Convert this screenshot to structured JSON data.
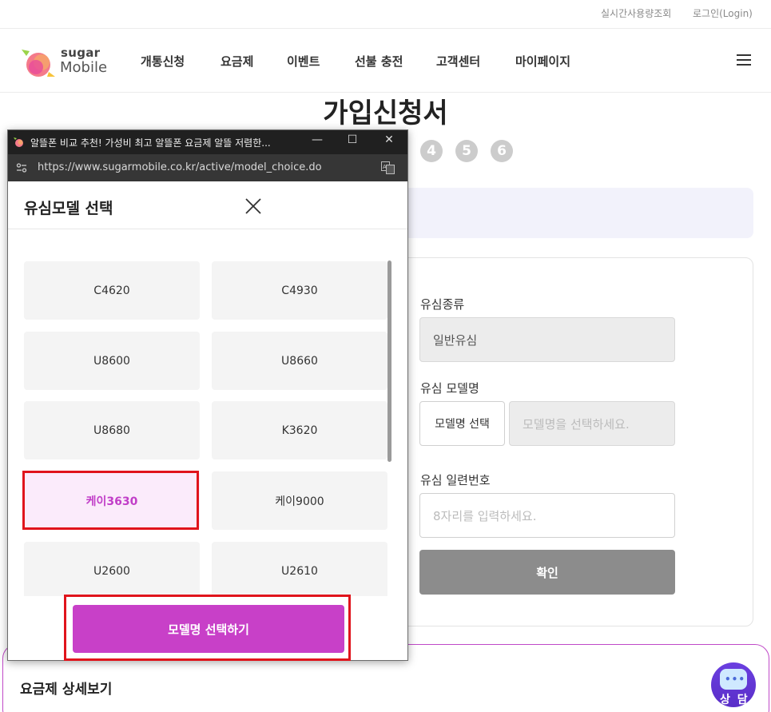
{
  "topbar": {
    "realtime_usage": "실시간사용량조회",
    "login": "로그인(Login)"
  },
  "header": {
    "logo": {
      "line1": "sugar",
      "line2": "Mobile"
    },
    "nav": [
      "개통신청",
      "요금제",
      "이벤트",
      "선불 충전",
      "고객센터",
      "마이페이지"
    ],
    "menu_icon": "hamburger-icon"
  },
  "page": {
    "title": "가입신청서",
    "steps": [
      "4",
      "5",
      "6"
    ]
  },
  "form": {
    "sim_type_label": "유심종류",
    "sim_type_value": "일반유심",
    "sim_model_label": "유심 모델명",
    "model_select_button": "모델명 선택",
    "model_placeholder": "모델명을 선택하세요.",
    "serial_label": "유심 일련번호",
    "serial_placeholder": "8자리를 입력하세요.",
    "confirm_button": "확인"
  },
  "plan_detail": {
    "title": "요금제 상세보기"
  },
  "chat": {
    "label": "상 담",
    "dots": "•••",
    "accent": "#5a2ec8"
  },
  "popup": {
    "window_title": "알뜰폰 비교 추천! 가성비 최고 알뜰폰 요금제 알뜰 저렴한...",
    "window_controls": {
      "minimize": "—",
      "maximize": "☐",
      "close": "✕"
    },
    "url": "https://www.sugarmobile.co.kr/active/model_choice.do",
    "title": "유심모델 선택",
    "models": [
      "C4620",
      "C4930",
      "U8600",
      "U8660",
      "U8680",
      "K3620",
      "케이3630",
      "케이9000",
      "U2600",
      "U2610"
    ],
    "selected_model": "케이3630",
    "select_button": "모델명 선택하기"
  },
  "colors": {
    "brand": "#c840c8",
    "selected_bg": "#fbebfb",
    "highlight": "#e0141c",
    "confirm_gray": "#8c8c8c"
  }
}
